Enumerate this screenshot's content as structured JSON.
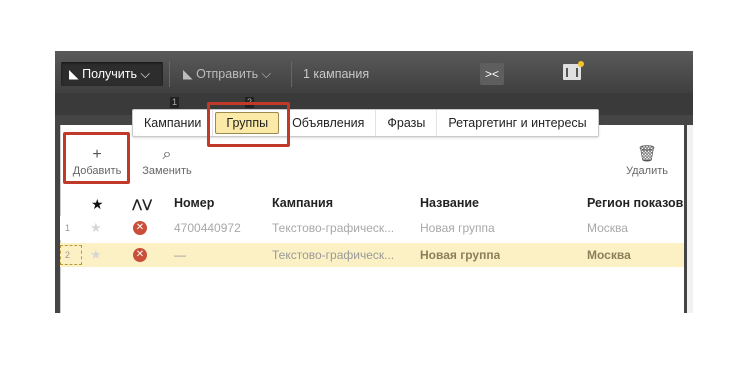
{
  "toolbar": {
    "get_label": "Получить",
    "send_label": "Отправить",
    "campaign_count": "1 кампания"
  },
  "subbar": {
    "marker_1": "1",
    "marker_2": "2"
  },
  "tabs": [
    {
      "label": "Кампании"
    },
    {
      "label": "Группы"
    },
    {
      "label": "Объявления"
    },
    {
      "label": "Фразы"
    },
    {
      "label": "Ретаргетинг и интересы"
    }
  ],
  "active_tab": "Группы",
  "actions": {
    "add_label": "Добавить",
    "replace_label": "Заменить",
    "delete_label": "Удалить"
  },
  "table": {
    "columns": {
      "star": "★",
      "status": "",
      "number": "Номер",
      "campaign": "Кампания",
      "name": "Название",
      "region": "Регион показов"
    },
    "rows": [
      {
        "index": "1",
        "number": "4700440972",
        "campaign": "Текстово-графическ...",
        "name": "Новая группа",
        "region": "Москва"
      },
      {
        "index": "2",
        "number": "—",
        "campaign": "Текстово-графическ...",
        "name": "Новая группа",
        "region": "Москва"
      }
    ]
  },
  "colors": {
    "highlight_border": "#c0392b",
    "active_tab_bg": "#fbe9a8",
    "selected_row_bg": "#fcf1c5",
    "status_error": "#c94f3a"
  }
}
